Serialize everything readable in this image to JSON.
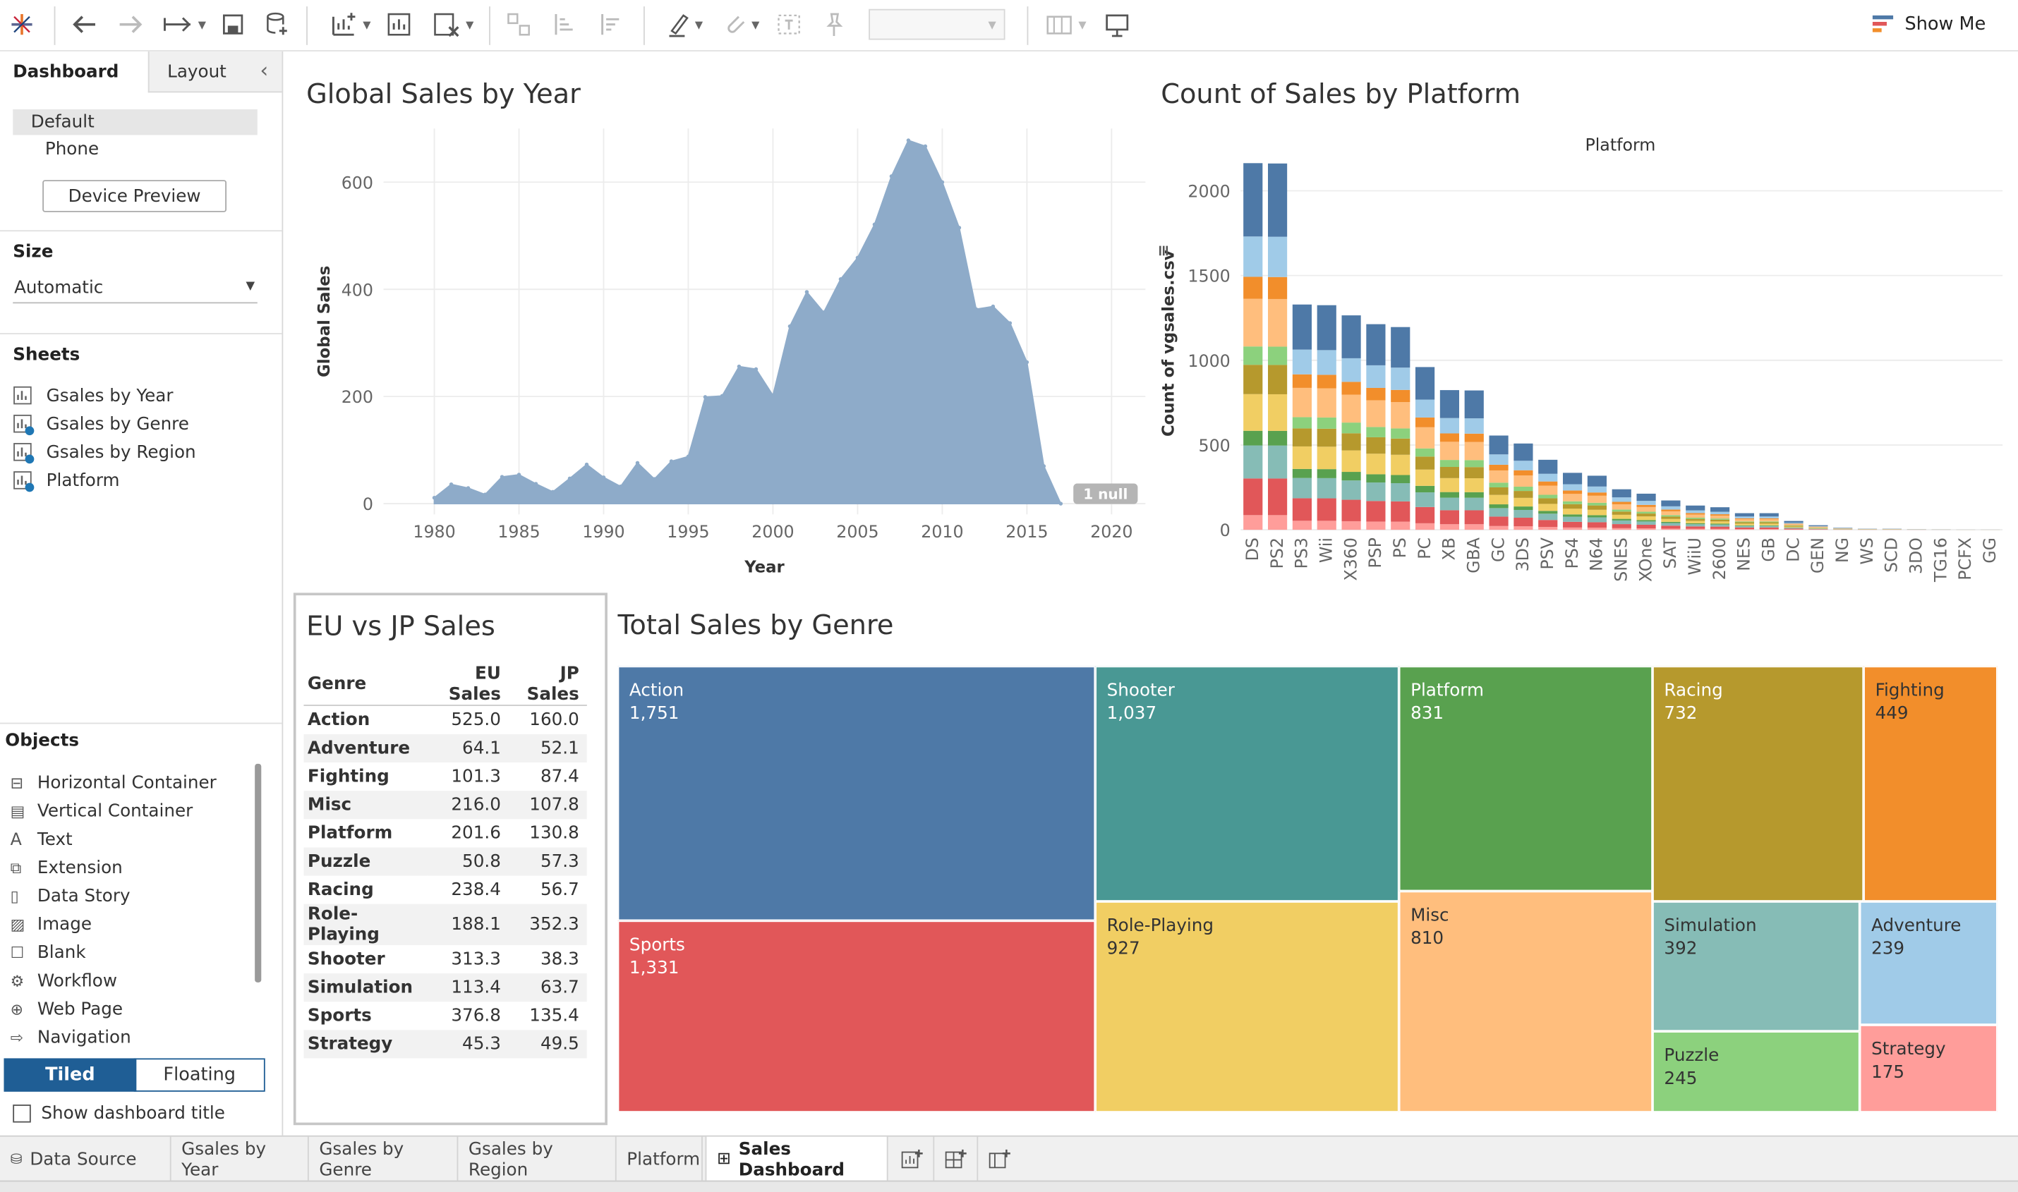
{
  "toolbar": {
    "show_me": "Show Me"
  },
  "left": {
    "tabs": [
      "Dashboard",
      "Layout"
    ],
    "devices": [
      "Default",
      "Phone"
    ],
    "device_preview": "Device Preview",
    "size_label": "Size",
    "size_value": "Automatic",
    "sheets_label": "Sheets",
    "sheets": [
      "Gsales by Year",
      "Gsales by Genre",
      "Gsales by Region",
      "Platform"
    ],
    "objects_label": "Objects",
    "objects": [
      "Horizontal Container",
      "Vertical Container",
      "Text",
      "Extension",
      "Data Story",
      "Image",
      "Blank",
      "Workflow",
      "Web Page",
      "Navigation"
    ],
    "tiled": "Tiled",
    "floating": "Floating",
    "show_title": "Show dashboard title"
  },
  "year_chart": {
    "title": "Global Sales by Year",
    "chart_data": {
      "type": "area",
      "xlabel": "Year",
      "ylabel": "Global Sales",
      "xlim": [
        1977,
        2022
      ],
      "ylim": [
        -20,
        700
      ],
      "xticks": [
        1980,
        1985,
        1990,
        1995,
        2000,
        2005,
        2010,
        2015,
        2020
      ],
      "yticks": [
        0,
        200,
        400,
        600
      ],
      "x": [
        1980,
        1981,
        1982,
        1983,
        1984,
        1985,
        1986,
        1987,
        1988,
        1989,
        1990,
        1991,
        1992,
        1993,
        1994,
        1995,
        1996,
        1997,
        1998,
        1999,
        2000,
        2001,
        2002,
        2003,
        2004,
        2005,
        2006,
        2007,
        2008,
        2009,
        2010,
        2011,
        2012,
        2013,
        2014,
        2015,
        2016,
        2017
      ],
      "y": [
        11,
        36,
        29,
        17,
        50,
        54,
        37,
        22,
        47,
        73,
        49,
        32,
        76,
        46,
        79,
        88,
        199,
        201,
        256,
        251,
        202,
        331,
        395,
        357,
        419,
        459,
        521,
        611,
        678,
        667,
        600,
        515,
        363,
        368,
        337,
        264,
        70,
        0
      ],
      "null_badge": "1 null"
    }
  },
  "platform_chart": {
    "title": "Count of Sales by Platform",
    "chart_data": {
      "type": "bar",
      "stacked": true,
      "column_header": "Platform",
      "ylabel": "Count of vgsales.csv",
      "ylim": [
        0,
        2200
      ],
      "yticks": [
        0,
        500,
        1000,
        1500,
        2000
      ],
      "categories": [
        "DS",
        "PS2",
        "PS3",
        "Wii",
        "X360",
        "PSP",
        "PS",
        "PC",
        "XB",
        "GBA",
        "GC",
        "3DS",
        "PSV",
        "PS4",
        "N64",
        "SNES",
        "XOne",
        "SAT",
        "WiiU",
        "2600",
        "NES",
        "GB",
        "DC",
        "GEN",
        "NG",
        "WS",
        "SCD",
        "3DO",
        "TG16",
        "PCFX",
        "GG"
      ],
      "values": [
        2163,
        2161,
        1329,
        1325,
        1265,
        1213,
        1196,
        960,
        824,
        822,
        556,
        509,
        413,
        336,
        319,
        239,
        213,
        173,
        143,
        133,
        98,
        98,
        52,
        27,
        12,
        6,
        6,
        3,
        2,
        1,
        1
      ],
      "segment_colors": [
        "#ff9d9a",
        "#e15759",
        "#86bcb6",
        "#59a14f",
        "#f1ce63",
        "#b6992d",
        "#8cd17d",
        "#ffbe7d",
        "#f28e2b",
        "#a0cbe8",
        "#4e79a7"
      ]
    }
  },
  "eu_jp": {
    "title": "EU vs JP Sales",
    "columns": [
      "Genre",
      "EU Sales",
      "JP Sales"
    ],
    "rows": [
      [
        "Action",
        "525.0",
        "160.0"
      ],
      [
        "Adventure",
        "64.1",
        "52.1"
      ],
      [
        "Fighting",
        "101.3",
        "87.4"
      ],
      [
        "Misc",
        "216.0",
        "107.8"
      ],
      [
        "Platform",
        "201.6",
        "130.8"
      ],
      [
        "Puzzle",
        "50.8",
        "57.3"
      ],
      [
        "Racing",
        "238.4",
        "56.7"
      ],
      [
        "Role-Playing",
        "188.1",
        "352.3"
      ],
      [
        "Shooter",
        "313.3",
        "38.3"
      ],
      [
        "Simulation",
        "113.4",
        "63.7"
      ],
      [
        "Sports",
        "376.8",
        "135.4"
      ],
      [
        "Strategy",
        "45.3",
        "49.5"
      ]
    ]
  },
  "genre_chart": {
    "title": "Total Sales by Genre",
    "cells": [
      {
        "label": "Action",
        "value": "1,751",
        "color": "#4e79a7"
      },
      {
        "label": "Sports",
        "value": "1,331",
        "color": "#e15759"
      },
      {
        "label": "Shooter",
        "value": "1,037",
        "color": "#499894"
      },
      {
        "label": "Role-Playing",
        "value": "927",
        "color": "#f1ce63"
      },
      {
        "label": "Platform",
        "value": "831",
        "color": "#59a14f"
      },
      {
        "label": "Misc",
        "value": "810",
        "color": "#ffbe7d"
      },
      {
        "label": "Racing",
        "value": "732",
        "color": "#b6992d"
      },
      {
        "label": "Simulation",
        "value": "392",
        "color": "#86bcb6"
      },
      {
        "label": "Puzzle",
        "value": "245",
        "color": "#8cd17d"
      },
      {
        "label": "Fighting",
        "value": "449",
        "color": "#f28e2b"
      },
      {
        "label": "Adventure",
        "value": "239",
        "color": "#a0cbe8"
      },
      {
        "label": "Strategy",
        "value": "175",
        "color": "#ff9d9a"
      }
    ]
  },
  "tabs": [
    "Data Source",
    "Gsales by Year",
    "Gsales by Genre",
    "Gsales by Region",
    "Platform",
    "Sales Dashboard"
  ]
}
